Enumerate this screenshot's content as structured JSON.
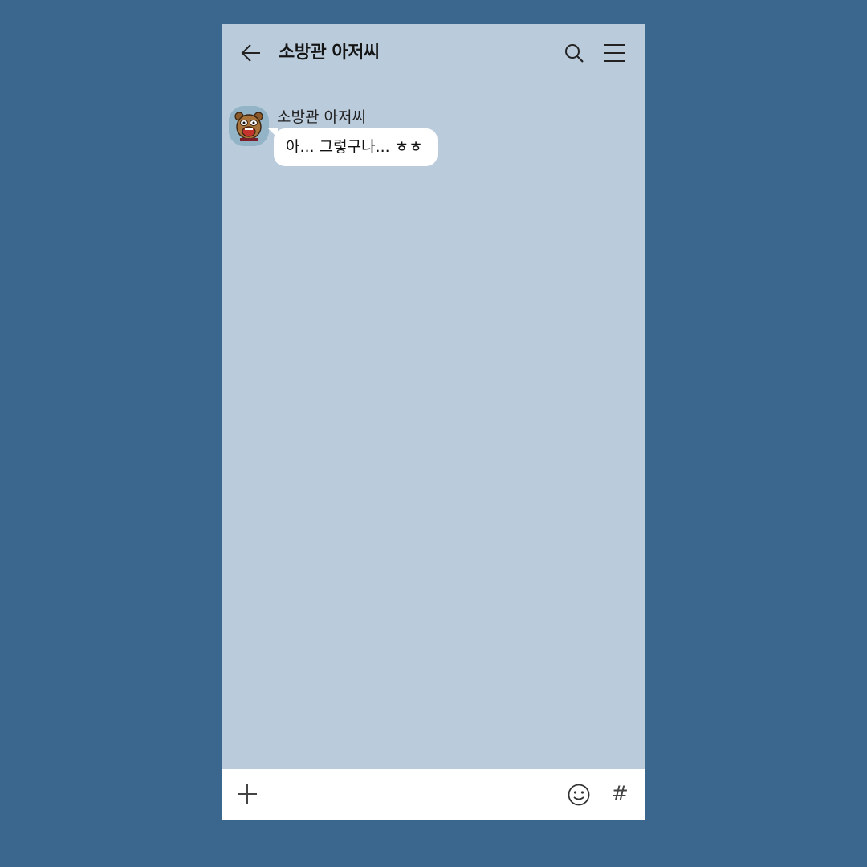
{
  "header": {
    "title": "소방관 아저씨",
    "back_icon": "arrow-left-icon",
    "search_icon": "search-icon",
    "menu_icon": "hamburger-menu-icon"
  },
  "messages": [
    {
      "sender": "소방관 아저씨",
      "text": "아... 그렇구나... ㅎㅎ",
      "avatar_icon": "bear-character-avatar"
    }
  ],
  "input_bar": {
    "placeholder": "",
    "plus_icon": "plus-icon",
    "emoji_icon": "emoji-icon",
    "hash_label": "#"
  },
  "colors": {
    "page_background": "#3b668e",
    "chat_background": "#bacbdc",
    "bubble": "#ffffff",
    "input_bar": "#ffffff"
  }
}
